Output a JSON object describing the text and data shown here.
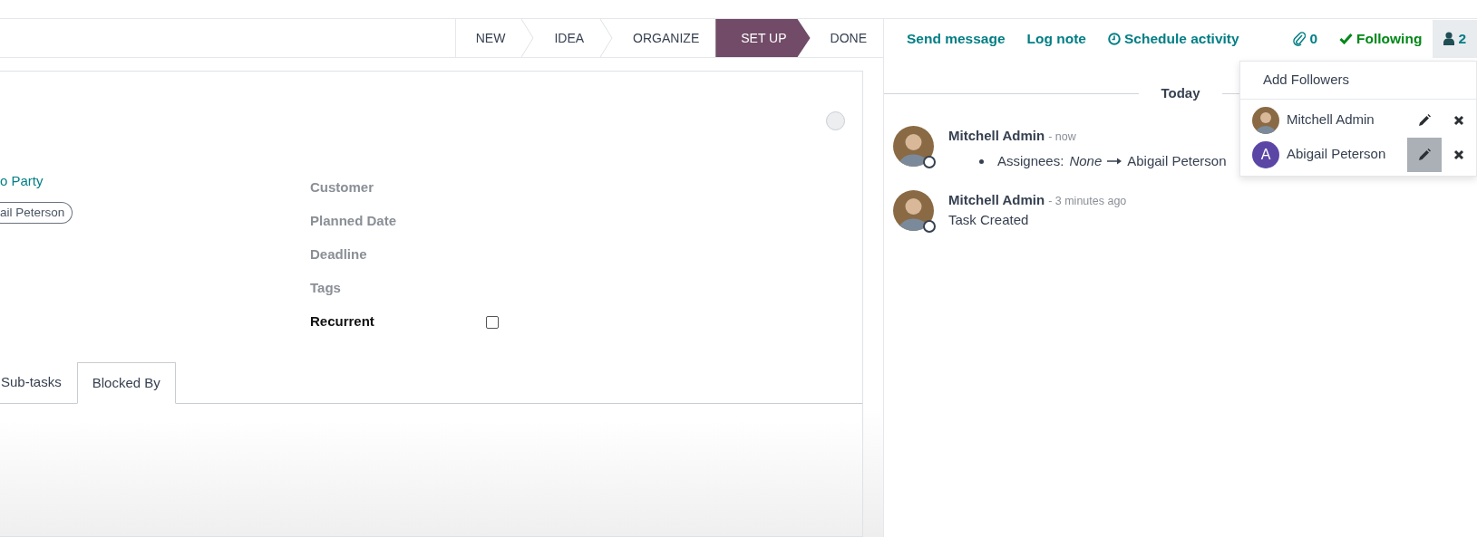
{
  "statusbar": [
    {
      "label": "NEW",
      "selected": false
    },
    {
      "label": "IDEA",
      "selected": false
    },
    {
      "label": "ORGANIZE",
      "selected": false
    },
    {
      "label": "SET UP",
      "selected": true
    },
    {
      "label": "DONE",
      "selected": false
    }
  ],
  "form": {
    "project_link": "o Party",
    "assignee_tag": "ail Peterson",
    "fields": [
      {
        "label": "Customer",
        "kind": "text"
      },
      {
        "label": "Planned Date",
        "kind": "text"
      },
      {
        "label": "Deadline",
        "kind": "text"
      },
      {
        "label": "Tags",
        "kind": "text"
      },
      {
        "label": "Recurrent",
        "kind": "checkbox",
        "checked": false
      }
    ],
    "tabs": [
      {
        "label": "Sub-tasks",
        "selected": false
      },
      {
        "label": "Blocked By",
        "selected": true
      }
    ]
  },
  "chatter": {
    "actions": [
      {
        "label": "Send message",
        "kind": "plain"
      },
      {
        "label": "Log note",
        "kind": "plain"
      },
      {
        "label": "Schedule activity",
        "kind": "activity"
      }
    ],
    "attachments_count": "0",
    "following": {
      "label": "Following",
      "on": true
    },
    "followers_count": "2",
    "followers_expanded": true,
    "day_separator": "Today",
    "messages": [
      {
        "author": "Mitchell Admin",
        "time": "- now",
        "changes": [
          {
            "field": "Assignees:",
            "old": "None",
            "new": "Abigail Peterson"
          }
        ]
      },
      {
        "author": "Mitchell Admin",
        "time": "- 3 minutes ago",
        "body": "Task Created"
      }
    ],
    "followers_menu": {
      "add_label": "Add Followers",
      "followers": [
        {
          "name": "Mitchell Admin",
          "kind": "photo",
          "edit_hovered": false
        },
        {
          "name": "Abigail Peterson",
          "kind": "letter",
          "initial": "A",
          "color": "#5b46a6",
          "edit_hovered": true
        }
      ]
    }
  }
}
